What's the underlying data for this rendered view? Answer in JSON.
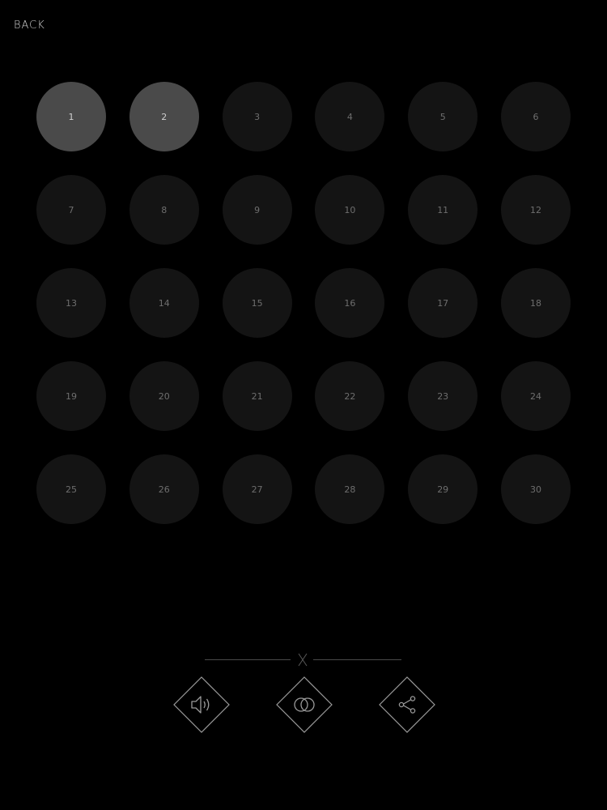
{
  "header": {
    "back_label": "BACK"
  },
  "levels": [
    {
      "label": "1",
      "unlocked": true
    },
    {
      "label": "2",
      "unlocked": true
    },
    {
      "label": "3",
      "unlocked": false
    },
    {
      "label": "4",
      "unlocked": false
    },
    {
      "label": "5",
      "unlocked": false
    },
    {
      "label": "6",
      "unlocked": false
    },
    {
      "label": "7",
      "unlocked": false
    },
    {
      "label": "8",
      "unlocked": false
    },
    {
      "label": "9",
      "unlocked": false
    },
    {
      "label": "10",
      "unlocked": false
    },
    {
      "label": "11",
      "unlocked": false
    },
    {
      "label": "12",
      "unlocked": false
    },
    {
      "label": "13",
      "unlocked": false
    },
    {
      "label": "14",
      "unlocked": false
    },
    {
      "label": "15",
      "unlocked": false
    },
    {
      "label": "16",
      "unlocked": false
    },
    {
      "label": "17",
      "unlocked": false
    },
    {
      "label": "18",
      "unlocked": false
    },
    {
      "label": "19",
      "unlocked": false
    },
    {
      "label": "20",
      "unlocked": false
    },
    {
      "label": "21",
      "unlocked": false
    },
    {
      "label": "22",
      "unlocked": false
    },
    {
      "label": "23",
      "unlocked": false
    },
    {
      "label": "24",
      "unlocked": false
    },
    {
      "label": "25",
      "unlocked": false
    },
    {
      "label": "26",
      "unlocked": false
    },
    {
      "label": "27",
      "unlocked": false
    },
    {
      "label": "28",
      "unlocked": false
    },
    {
      "label": "29",
      "unlocked": false
    },
    {
      "label": "30",
      "unlocked": false
    }
  ],
  "toolbar": {
    "buttons": [
      {
        "name": "sound-button",
        "icon": "speaker-icon"
      },
      {
        "name": "modes-button",
        "icon": "overlapping-circles-icon"
      },
      {
        "name": "share-button",
        "icon": "share-icon"
      }
    ]
  },
  "colors": {
    "background": "#000000",
    "locked_circle": "#141414",
    "unlocked_circle": "#4a4a4a",
    "icon_stroke": "#9a9a9a"
  }
}
